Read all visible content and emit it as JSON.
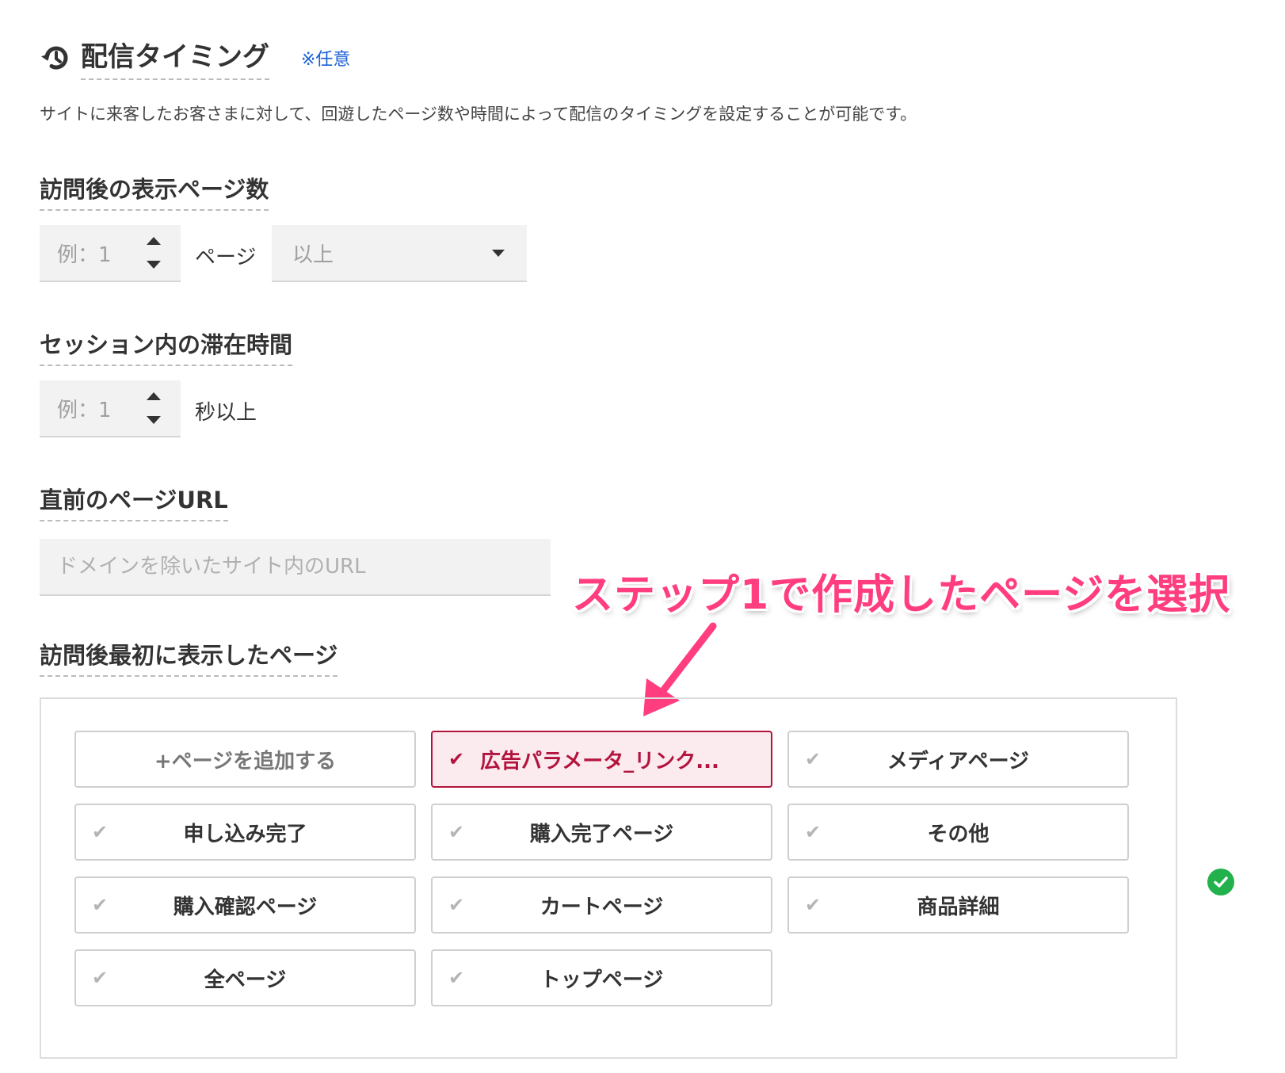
{
  "section": {
    "title": "配信タイミング",
    "optional": "※任意",
    "description": "サイトに来客したお客さまに対して、回遊したページ数や時間によって配信のタイミングを設定することが可能です。"
  },
  "page_count": {
    "label": "訪問後の表示ページ数",
    "placeholder": "例：1",
    "unit": "ページ",
    "condition": "以上"
  },
  "session_time": {
    "label": "セッション内の滞在時間",
    "placeholder": "例：1",
    "unit": "秒以上"
  },
  "prev_url": {
    "label": "直前のページURL",
    "placeholder": "ドメインを除いたサイト内のURL"
  },
  "first_page": {
    "label": "訪問後最初に表示したページ",
    "add_button": "ページを追加する",
    "pages": [
      {
        "label": "広告パラメータ_リンク...",
        "selected": true
      },
      {
        "label": "メディアページ",
        "selected": false
      },
      {
        "label": "申し込み完了",
        "selected": false
      },
      {
        "label": "購入完了ページ",
        "selected": false
      },
      {
        "label": "その他",
        "selected": false
      },
      {
        "label": "購入確認ページ",
        "selected": false
      },
      {
        "label": "カートページ",
        "selected": false
      },
      {
        "label": "商品詳細",
        "selected": false
      },
      {
        "label": "全ページ",
        "selected": false
      },
      {
        "label": "トップページ",
        "selected": false
      }
    ]
  },
  "annotation": {
    "callout": "ステップ1で作成したページを選択",
    "color": "#ff3d7f"
  },
  "colors": {
    "selected": "#b3143e",
    "selected_bg": "#fbeaee",
    "valid": "#22b14c",
    "link": "#1a5fd6"
  }
}
